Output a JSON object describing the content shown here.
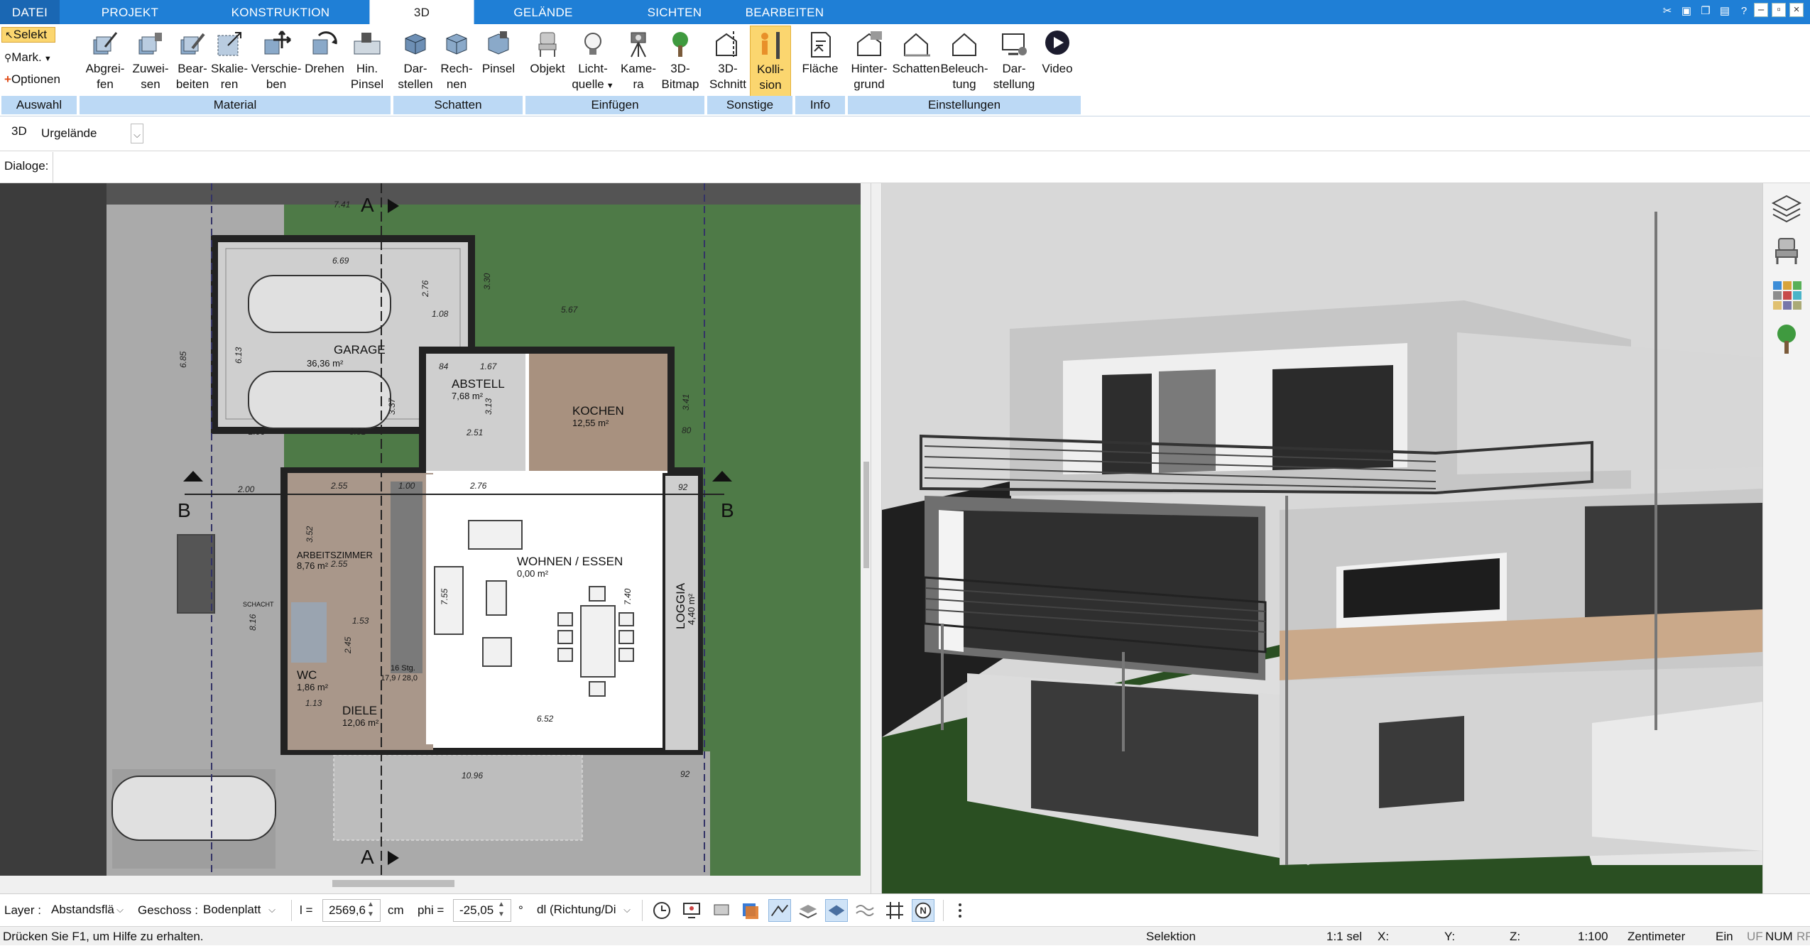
{
  "tabs": [
    {
      "label": "DATEI"
    },
    {
      "label": "PROJEKT"
    },
    {
      "label": "KONSTRUKTION"
    },
    {
      "label": "3D"
    },
    {
      "label": "GELÄNDE"
    },
    {
      "label": "SICHTEN"
    },
    {
      "label": "BEARBEITEN"
    }
  ],
  "ribbon": {
    "auswahl": {
      "selekt": "Selekt",
      "mark": "Mark.",
      "optionen": "Optionen"
    },
    "buttons": [
      {
        "l1": "Abgrei-",
        "l2": "fen"
      },
      {
        "l1": "Zuwei-",
        "l2": "sen"
      },
      {
        "l1": "Bear-",
        "l2": "beiten"
      },
      {
        "l1": "Skalie-",
        "l2": "ren"
      },
      {
        "l1": "Verschie-",
        "l2": "ben"
      },
      {
        "l1": "Drehen",
        "l2": ""
      },
      {
        "l1": "Hin.",
        "l2": "Pinsel"
      },
      {
        "l1": "Dar-",
        "l2": "stellen"
      },
      {
        "l1": "Rech-",
        "l2": "nen"
      },
      {
        "l1": "Pinsel",
        "l2": ""
      },
      {
        "l1": "Objekt",
        "l2": ""
      },
      {
        "l1": "Licht-",
        "l2": "quelle"
      },
      {
        "l1": "Kame-",
        "l2": "ra"
      },
      {
        "l1": "3D-",
        "l2": "Bitmap"
      },
      {
        "l1": "3D-",
        "l2": "Schnitt"
      },
      {
        "l1": "Kolli-",
        "l2": "sion"
      },
      {
        "l1": "Fläche",
        "l2": ""
      },
      {
        "l1": "Hinter-",
        "l2": "grund"
      },
      {
        "l1": "Schatten",
        "l2": ""
      },
      {
        "l1": "Beleuch-",
        "l2": "tung"
      },
      {
        "l1": "Dar-",
        "l2": "stellung"
      },
      {
        "l1": "Video",
        "l2": ""
      }
    ],
    "groups": [
      "Auswahl",
      "Material",
      "Schatten",
      "Einfügen",
      "Sonstige",
      "Info",
      "Einstellungen"
    ]
  },
  "toolbar3d": {
    "mode": "3D",
    "combo": "Urgelände"
  },
  "dialoge": {
    "label": "Dialoge:"
  },
  "plan": {
    "rooms": [
      {
        "name": "GARAGE",
        "area": "36,36 m²"
      },
      {
        "name": "ABSTELL",
        "area": "7,68 m²"
      },
      {
        "name": "KOCHEN",
        "area": "12,55 m²"
      },
      {
        "name": "WOHNEN / ESSEN",
        "area": "0,00 m²"
      },
      {
        "name": "ARBEITSZIMMER",
        "area": "8,76 m²"
      },
      {
        "name": "WC",
        "area": "1,86 m²"
      },
      {
        "name": "DIELE",
        "area": "12,06 m²"
      },
      {
        "name": "LOGGIA",
        "area": "4,40 m²"
      }
    ],
    "dims": [
      "7.41",
      "6.69",
      "5.67",
      "2.76",
      "1.08",
      "3.30",
      "6.85",
      "6.13",
      "2.06",
      "3.81",
      "3.37",
      "1.67",
      "84",
      "3.13",
      "2.51",
      "3.41",
      "80",
      "2.55",
      "1.00",
      "2.76",
      "92",
      "2.00",
      "3.52",
      "2.55",
      "7.55",
      "7.40",
      "1.53",
      "2.45",
      "6.52",
      "10.96",
      "92",
      "1.13",
      "8.16"
    ],
    "labels": [
      "A",
      "A",
      "B",
      "B",
      "16 Stg.",
      "17,9 / 28,0",
      "SCHACHT"
    ]
  },
  "bottom": {
    "layer_label": "Layer :",
    "layer_value": "Abstandsflä",
    "geschoss_label": "Geschoss :",
    "geschoss_value": "Bodenplatt",
    "l_label": "l =",
    "l_value": "2569,6",
    "l_unit": "cm",
    "phi_label": "phi =",
    "phi_value": "-25,05",
    "phi_unit": "°",
    "dl_value": "dl (Richtung/Di"
  },
  "status": {
    "help": "Drücken Sie F1, um Hilfe zu erhalten.",
    "mode": "Selektion",
    "sel": "1:1 sel",
    "x": "X:",
    "y": "Y:",
    "z": "Z:",
    "scale": "1:100",
    "unit": "Zentimeter",
    "ein": "Ein",
    "uf": "UF",
    "num": "NUM",
    "rf": "RF"
  },
  "colors": {
    "tabbar": "#1f7fd6",
    "ribbon_group": "#bcd9f5",
    "grass": "#4c7a48",
    "plan_bg": "#545454",
    "sky": "#d8d8d8"
  }
}
